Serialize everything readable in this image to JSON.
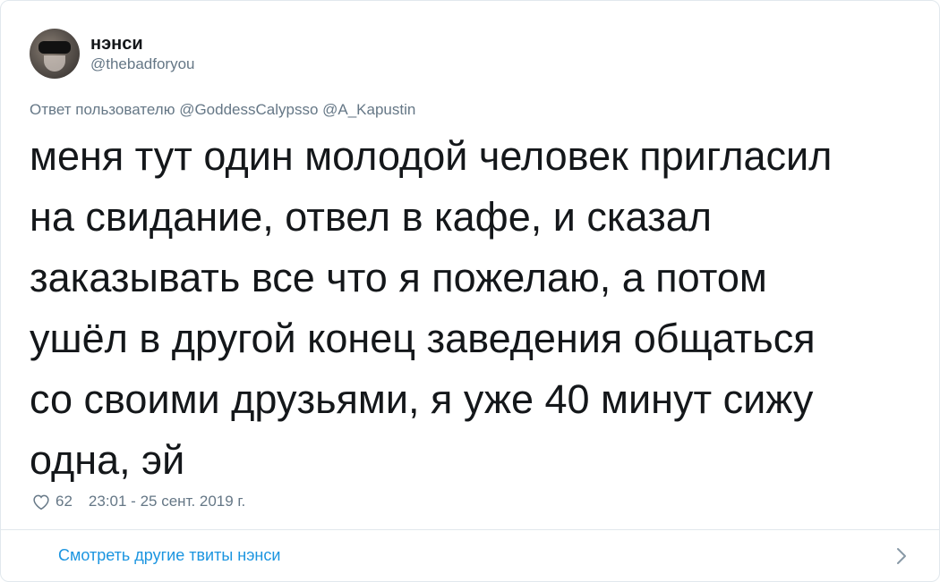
{
  "author": {
    "display_name": "нэнси",
    "handle": "@thebadforyou"
  },
  "reply_to": {
    "prefix": "Ответ пользователю",
    "mentions": "@GoddessCalypsso @A_Kapustin"
  },
  "tweet": {
    "text": "меня тут один молодой человек пригласил\nна свидание, отвел в кафе, и сказал\nзаказывать все что я пожелаю, а потом\nушёл в другой конец заведения общаться\nсо своими друзьями, я уже 40 минут сижу\nодна, эй"
  },
  "meta": {
    "likes": "62",
    "timestamp": "23:01 - 25 сент. 2019 г."
  },
  "footer": {
    "more_tweets_label": "Смотреть другие твиты нэнси"
  },
  "icons": {
    "heart": "heart-icon",
    "chevron": "chevron-right-icon"
  },
  "colors": {
    "text_primary": "#14171a",
    "text_secondary": "#657786",
    "link": "#1b95e0",
    "border": "#e1e8ed"
  }
}
